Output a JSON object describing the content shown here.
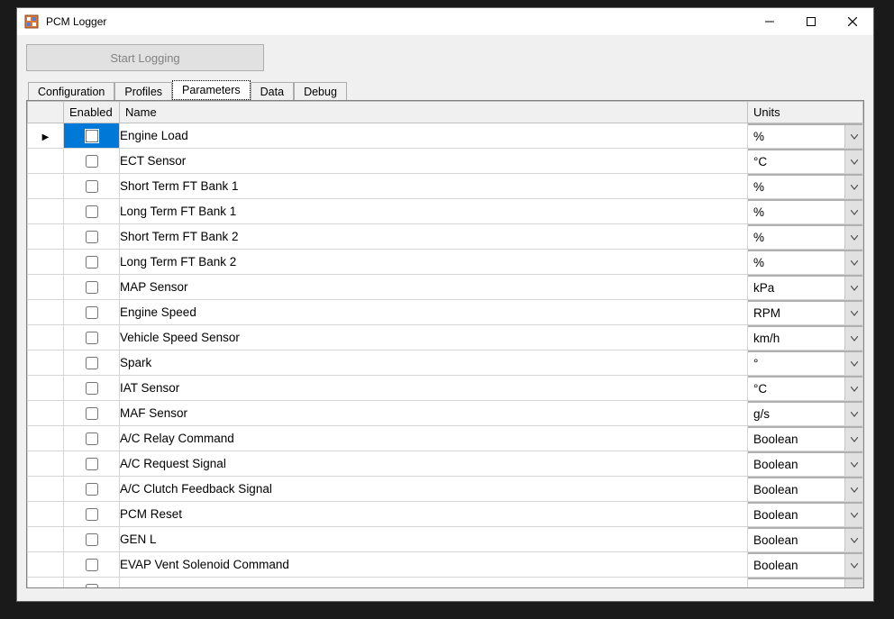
{
  "window": {
    "title": "PCM Logger"
  },
  "toolbar": {
    "start_logging_label": "Start Logging"
  },
  "tabs": [
    {
      "label": "Configuration",
      "active": false
    },
    {
      "label": "Profiles",
      "active": false
    },
    {
      "label": "Parameters",
      "active": true
    },
    {
      "label": "Data",
      "active": false
    },
    {
      "label": "Debug",
      "active": false
    }
  ],
  "grid": {
    "columns": {
      "enabled": "Enabled",
      "name": "Name",
      "units": "Units"
    },
    "rows": [
      {
        "selected": true,
        "enabled": false,
        "name": "Engine Load",
        "units": "%"
      },
      {
        "selected": false,
        "enabled": false,
        "name": "ECT Sensor",
        "units": "°C"
      },
      {
        "selected": false,
        "enabled": false,
        "name": "Short Term FT Bank 1",
        "units": "%"
      },
      {
        "selected": false,
        "enabled": false,
        "name": "Long Term FT Bank 1",
        "units": "%"
      },
      {
        "selected": false,
        "enabled": false,
        "name": "Short Term FT Bank 2",
        "units": "%"
      },
      {
        "selected": false,
        "enabled": false,
        "name": "Long Term FT Bank 2",
        "units": "%"
      },
      {
        "selected": false,
        "enabled": false,
        "name": "MAP Sensor",
        "units": "kPa"
      },
      {
        "selected": false,
        "enabled": false,
        "name": "Engine Speed",
        "units": "RPM"
      },
      {
        "selected": false,
        "enabled": false,
        "name": "Vehicle Speed Sensor",
        "units": "km/h"
      },
      {
        "selected": false,
        "enabled": false,
        "name": "Spark",
        "units": "°"
      },
      {
        "selected": false,
        "enabled": false,
        "name": "IAT Sensor",
        "units": "°C"
      },
      {
        "selected": false,
        "enabled": false,
        "name": "MAF Sensor",
        "units": "g/s"
      },
      {
        "selected": false,
        "enabled": false,
        "name": "A/C Relay Command",
        "units": "Boolean"
      },
      {
        "selected": false,
        "enabled": false,
        "name": "A/C Request Signal",
        "units": "Boolean"
      },
      {
        "selected": false,
        "enabled": false,
        "name": "A/C Clutch Feedback Signal",
        "units": "Boolean"
      },
      {
        "selected": false,
        "enabled": false,
        "name": "PCM Reset",
        "units": "Boolean"
      },
      {
        "selected": false,
        "enabled": false,
        "name": "GEN L",
        "units": "Boolean"
      },
      {
        "selected": false,
        "enabled": false,
        "name": "EVAP Vent Solenoid Command",
        "units": "Boolean"
      },
      {
        "selected": false,
        "enabled": false,
        "name": "",
        "units": ""
      }
    ]
  }
}
